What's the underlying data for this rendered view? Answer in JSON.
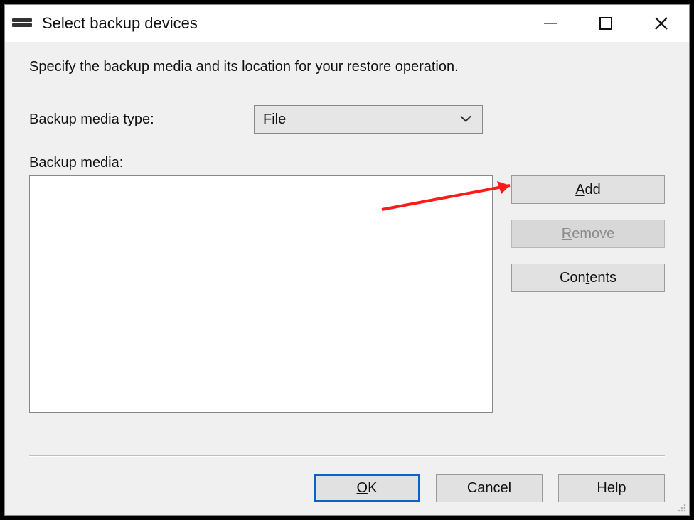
{
  "window": {
    "title": "Select backup devices"
  },
  "instruction": "Specify the backup media and its location for your restore operation.",
  "media_type": {
    "label": "Backup media type:",
    "underline_index": 0,
    "value": "File"
  },
  "media_list": {
    "label": "Backup media:",
    "underline_index": 7
  },
  "buttons": {
    "add": {
      "label": "Add",
      "underline_index": 0,
      "enabled": true
    },
    "remove": {
      "label": "Remove",
      "underline_index": 0,
      "enabled": false
    },
    "contents": {
      "label": "Contents",
      "underline_index": 3,
      "enabled": true
    },
    "ok": {
      "label": "OK",
      "underline_index": 0
    },
    "cancel": {
      "label": "Cancel"
    },
    "help": {
      "label": "Help"
    }
  },
  "annotation": {
    "arrow_points_to": "add-button",
    "color": "#ff1a1a"
  }
}
